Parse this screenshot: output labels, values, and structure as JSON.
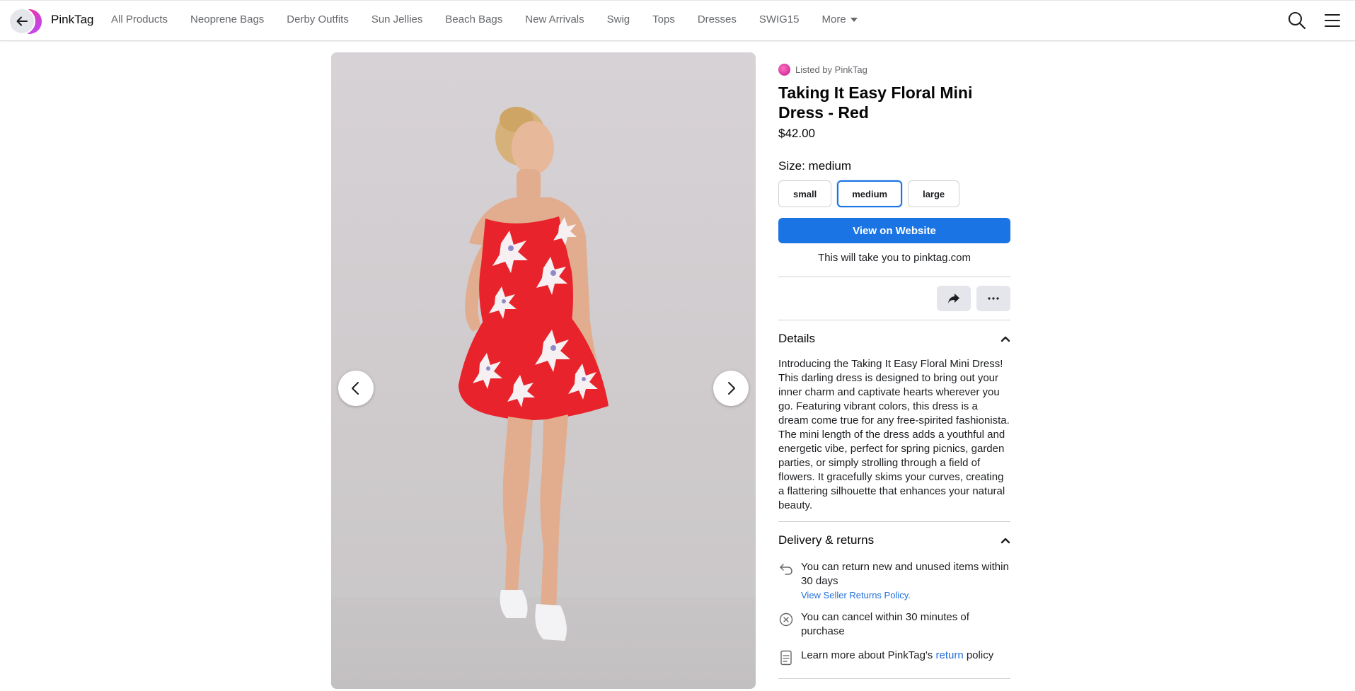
{
  "nav": {
    "brand": "PinkTag",
    "links": [
      "All Products",
      "Neoprene Bags",
      "Derby Outfits",
      "Sun Jellies",
      "Beach Bags",
      "New Arrivals",
      "Swig",
      "Tops",
      "Dresses",
      "SWIG15"
    ],
    "more_label": "More"
  },
  "viewer": {
    "image_alt": "Woman wearing red floral mini dress"
  },
  "product": {
    "listed_by": "Listed by PinkTag",
    "title": "Taking It Easy Floral Mini Dress - Red",
    "price": "$42.00",
    "size_label": "Size:",
    "size_selected": "medium",
    "sizes": [
      "small",
      "medium",
      "large"
    ],
    "view_button": "View on Website",
    "redirect_note": "This will take you to pinktag.com"
  },
  "details": {
    "heading": "Details",
    "text": "Introducing the Taking It Easy Floral Mini Dress! This darling dress is designed to bring out your inner charm and captivate hearts wherever you go. Featuring vibrant colors, this dress is a dream come true for any free-spirited fashionista. The mini length of the dress adds a youthful and energetic vibe, perfect for spring picnics, garden parties, or simply strolling through a field of flowers. It gracefully skims your curves, creating a flattering silhouette that enhances your natural beauty."
  },
  "delivery": {
    "heading": "Delivery & returns",
    "return_text": "You can return new and unused items within 30 days",
    "return_link": "View Seller Returns Policy.",
    "cancel_text": "You can cancel within 30 minutes of purchase",
    "learn_prefix": "Learn more about PinkTag's",
    "learn_link": "return",
    "learn_suffix": "policy"
  },
  "colors": {
    "accent": "#1b74e4",
    "link": "#216fdb",
    "dress": "#e8232b"
  }
}
